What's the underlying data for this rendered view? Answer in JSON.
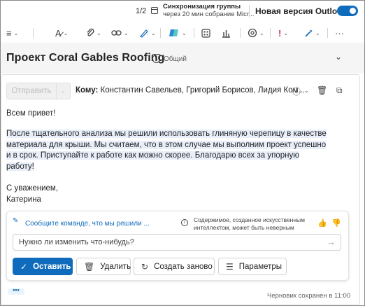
{
  "titlebar": {
    "pager": "1/2",
    "sync_title": "Синхронизация группы",
    "sync_subtitle": "через 20 мин собрание Micr...",
    "new_outlook_label": "Новая версия Outlook",
    "new_outlook_on": true,
    "accent_color": "#0f6cbd"
  },
  "ribbon": {
    "icons": [
      "format-icon",
      "format-painter-icon",
      "attach-icon",
      "link-icon",
      "sign-icon",
      "copilot-icon",
      "apps-icon",
      "chart-icon",
      "loop-icon",
      "importance-icon",
      "sensitivity-icon",
      "more-icon"
    ]
  },
  "message": {
    "subject": "Проект Coral Gables Roofing",
    "visibility": "Общий",
    "send_label": "Отправить",
    "to_label": "Кому:",
    "recipients": "Константин Савельев, Григорий Борисов, Лидия Ком...",
    "greeting": "Всем привет!",
    "paragraph_lines": [
      "После тщательного анализа мы решили использовать глиняную черепицу в качестве",
      "материала для крыши. Мы считаем, что в этом случае мы выполним проект успешно",
      "и в срок. Приступайте к работе как можно скорее. Благодарю всех за упорную",
      "работу!"
    ],
    "sign_off": "С уважением,",
    "signature": "Катерина"
  },
  "copilot": {
    "prompt_text": "Сообщите команде, что мы решили ...",
    "disclaimer": "Содержимое, созданное искусственным интеллектом, может быть неверным",
    "input_placeholder": "Нужно ли изменить что-нибудь?",
    "keep_label": "Оставить",
    "delete_label": "Удалить",
    "regenerate_label": "Создать заново",
    "options_label": "Параметры"
  },
  "footer": {
    "more_label": "•••",
    "draft_status": "Черновик сохранен в 11:00"
  }
}
